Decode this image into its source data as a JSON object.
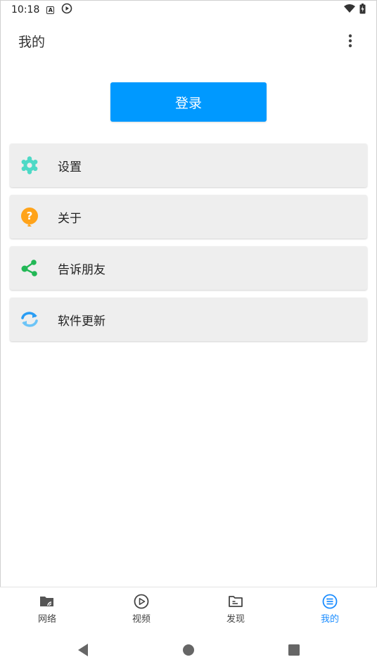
{
  "statusbar": {
    "time": "10:18",
    "a_icon_text": "A"
  },
  "appbar": {
    "title": "我的"
  },
  "login": {
    "label": "登录"
  },
  "menu": {
    "items": [
      {
        "label": "设置",
        "icon": "settings-gear-icon",
        "color": "#4dd9c6"
      },
      {
        "label": "关于",
        "icon": "question-bubble-icon",
        "color": "#ffa31a"
      },
      {
        "label": "告诉朋友",
        "icon": "share-icon",
        "color": "#22b856"
      },
      {
        "label": "软件更新",
        "icon": "refresh-icon",
        "color": "#2a9df4"
      }
    ]
  },
  "bottomnav": {
    "items": [
      {
        "label": "网络",
        "icon": "network-folder-icon"
      },
      {
        "label": "视频",
        "icon": "play-circle-icon"
      },
      {
        "label": "发现",
        "icon": "folder-doc-icon"
      },
      {
        "label": "我的",
        "icon": "mine-list-icon",
        "active": true
      }
    ]
  },
  "colors": {
    "primary": "#0099ff",
    "active_nav": "#1a8cff"
  }
}
